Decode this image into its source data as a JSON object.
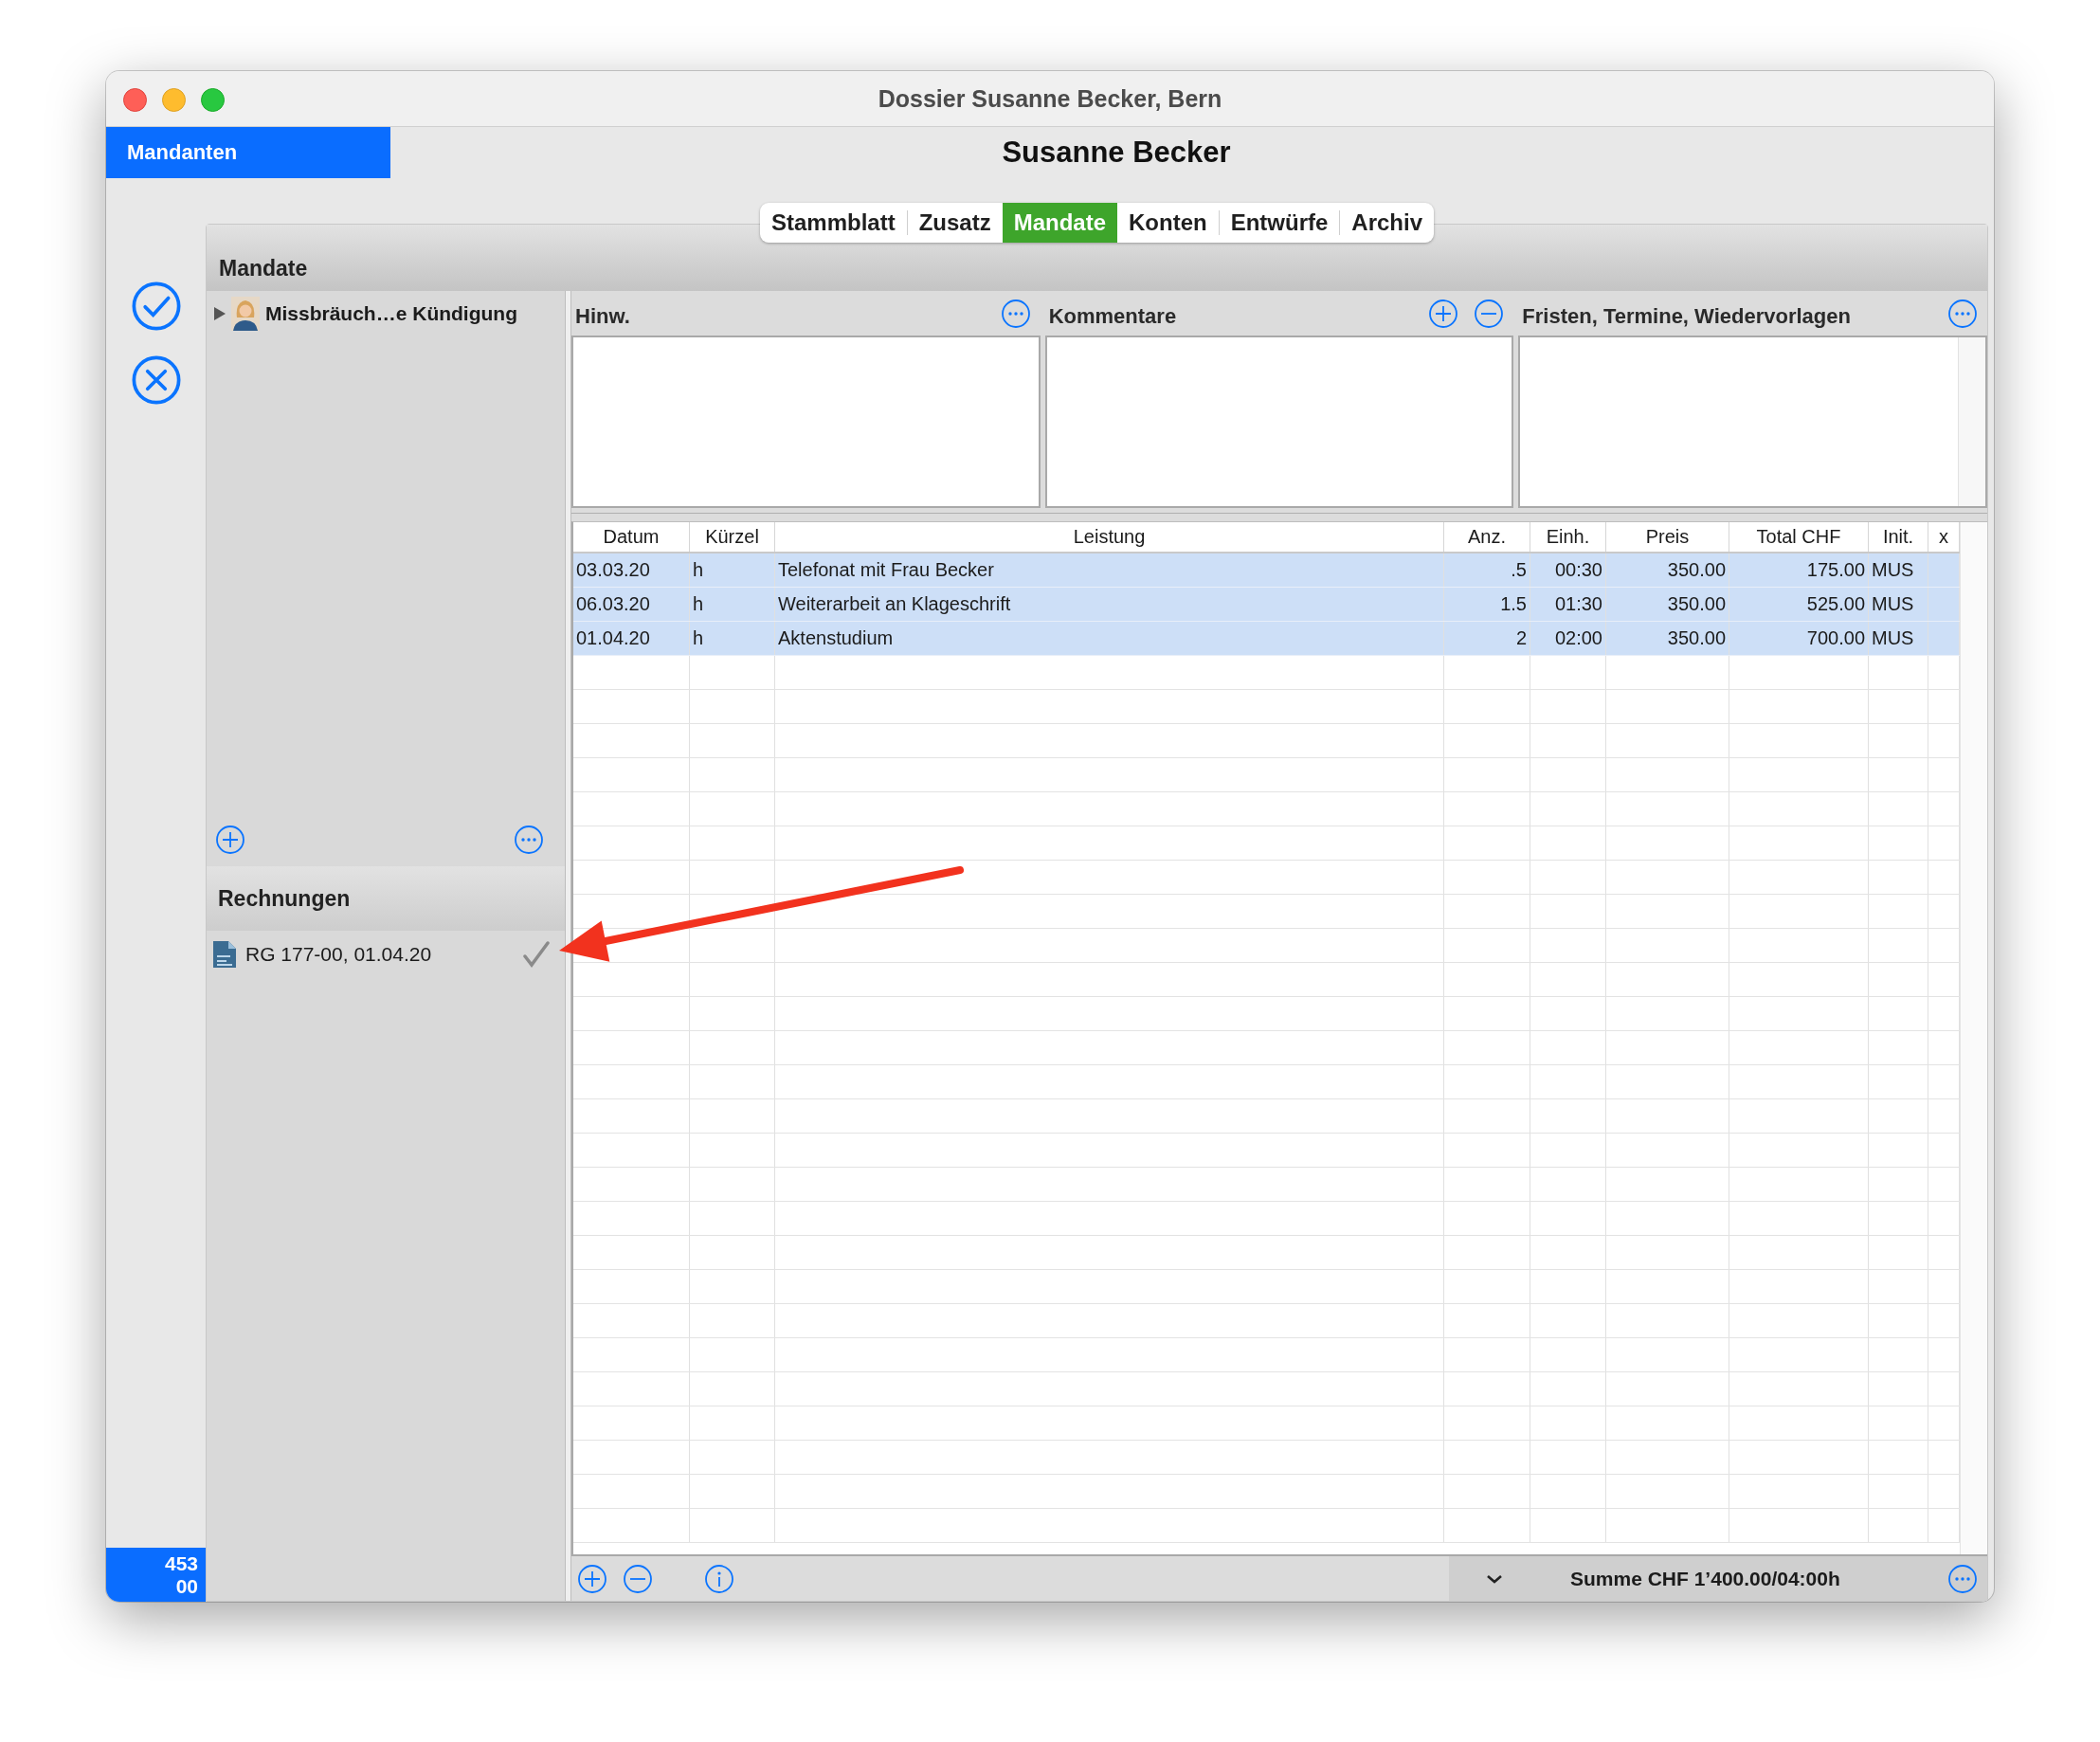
{
  "window": {
    "title": "Dossier Susanne Becker, Bern"
  },
  "nav_button": "Mandanten",
  "client_name": "Susanne Becker",
  "tabs": [
    {
      "label": "Stammblatt",
      "selected": false
    },
    {
      "label": "Zusatz",
      "selected": false
    },
    {
      "label": "Mandate",
      "selected": true
    },
    {
      "label": "Konten",
      "selected": false
    },
    {
      "label": "Entwürfe",
      "selected": false
    },
    {
      "label": "Archiv",
      "selected": false
    }
  ],
  "badge": {
    "line_1": "453",
    "line_2": "00"
  },
  "mandates": {
    "title": "Mandate",
    "items": [
      {
        "label": "Missbräuch…e Kündigung",
        "expanded": false
      }
    ]
  },
  "invoices": {
    "title": "Rechnungen",
    "items": [
      {
        "label": "RG 177-00, 01.04.20",
        "checked": true
      }
    ]
  },
  "notes": [
    {
      "title": "Hinw."
    },
    {
      "title": "Kommentare"
    },
    {
      "title": "Fristen, Termine, Wiedervorlagen"
    }
  ],
  "table": {
    "columns": [
      "Datum",
      "Kürzel",
      "Leistung",
      "Anz.",
      "Einh.",
      "Preis",
      "Total CHF",
      "Init.",
      "x"
    ],
    "rows": [
      {
        "cells": [
          "03.03.20",
          "h",
          "Telefonat mit Frau Becker",
          ".5",
          "00:30",
          "350.00",
          "175.00",
          "MUS"
        ],
        "selected": true
      },
      {
        "cells": [
          "06.03.20",
          "h",
          "Weiterarbeit an Klageschrift",
          "1.5",
          "01:30",
          "350.00",
          "525.00",
          "MUS"
        ],
        "selected": true
      },
      {
        "cells": [
          "01.04.20",
          "h",
          "Aktenstudium",
          "2",
          "02:00",
          "350.00",
          "700.00",
          "MUS"
        ],
        "selected": true
      }
    ]
  },
  "footer": {
    "sum": "Summe CHF 1’400.00/04:00h"
  }
}
